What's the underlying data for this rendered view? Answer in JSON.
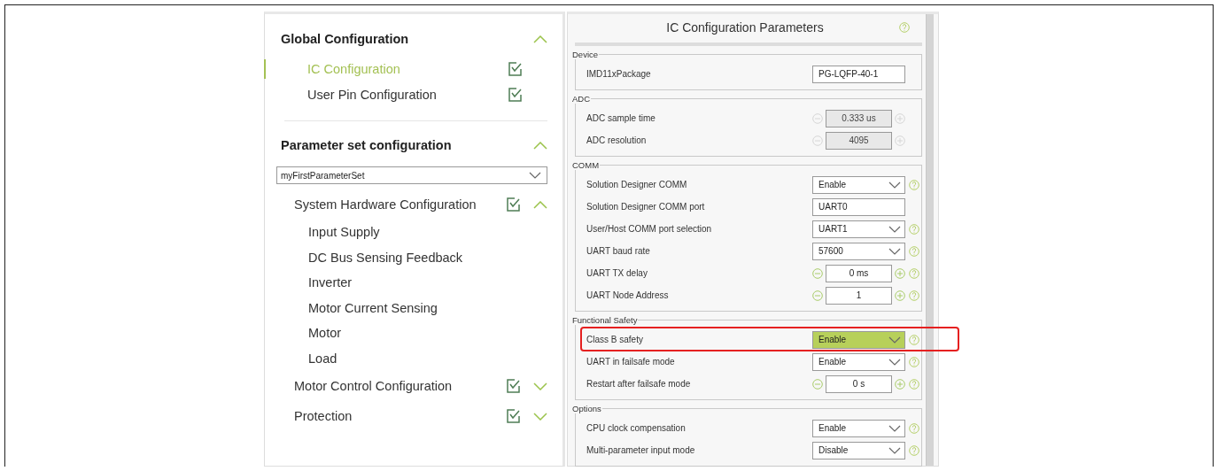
{
  "navigator": {
    "sections": [
      {
        "title": "Global Configuration",
        "expanded": true,
        "items": [
          {
            "label": "IC Configuration",
            "selected": true,
            "checked": true
          },
          {
            "label": "User Pin Configuration",
            "selected": false,
            "checked": true
          }
        ]
      },
      {
        "title": "Parameter set configuration",
        "expanded": true,
        "dropdown": {
          "value": "myFirstParameterSet"
        },
        "groups": [
          {
            "label": "System Hardware Configuration",
            "checked": true,
            "expanded": true,
            "children": [
              {
                "label": "Input Supply"
              },
              {
                "label": "DC Bus Sensing Feedback"
              },
              {
                "label": "Inverter"
              },
              {
                "label": "Motor Current Sensing"
              },
              {
                "label": "Motor"
              },
              {
                "label": "Load"
              }
            ]
          },
          {
            "label": "Motor Control Configuration",
            "checked": true,
            "expanded": false
          },
          {
            "label": "Protection",
            "checked": true,
            "expanded": false
          }
        ]
      }
    ]
  },
  "parameters": {
    "title": "IC Configuration Parameters",
    "groups": [
      {
        "legend": "Device",
        "rows": [
          {
            "label": "IMD11xPackage",
            "kind": "text",
            "value": "PG-LQFP-40-1",
            "help": false
          }
        ]
      },
      {
        "legend": "ADC",
        "rows": [
          {
            "label": "ADC sample time",
            "kind": "spin",
            "value": "0.333 us",
            "disabled": true,
            "help": false
          },
          {
            "label": "ADC resolution",
            "kind": "spin",
            "value": "4095",
            "disabled": true,
            "help": false
          }
        ]
      },
      {
        "legend": "COMM",
        "rows": [
          {
            "label": "Solution Designer COMM",
            "kind": "select",
            "value": "Enable",
            "help": true
          },
          {
            "label": "Solution Designer COMM port",
            "kind": "text",
            "value": "UART0",
            "help": false
          },
          {
            "label": "User/Host COMM port selection",
            "kind": "select",
            "value": "UART1",
            "help": true
          },
          {
            "label": "UART baud rate",
            "kind": "select",
            "value": "57600",
            "help": true
          },
          {
            "label": "UART TX delay",
            "kind": "spin",
            "value": "0 ms",
            "disabled": false,
            "help": true
          },
          {
            "label": "UART Node Address",
            "kind": "spin",
            "value": "1",
            "disabled": false,
            "help": true
          }
        ]
      },
      {
        "legend": "Functional Safety",
        "rows": [
          {
            "label": "Class B safety",
            "kind": "select",
            "value": "Enable",
            "help": true,
            "emphasized": true,
            "annotated": true
          },
          {
            "label": "UART in failsafe mode",
            "kind": "select",
            "value": "Enable",
            "help": true
          },
          {
            "label": "Restart after failsafe mode",
            "kind": "spin",
            "value": "0 s",
            "disabled": false,
            "help": true
          }
        ]
      },
      {
        "legend": "Options",
        "rows": [
          {
            "label": "CPU clock compensation",
            "kind": "select",
            "value": "Enable",
            "help": true
          },
          {
            "label": "Multi-parameter input mode",
            "kind": "select",
            "value": "Disable",
            "help": true
          }
        ]
      }
    ]
  }
}
